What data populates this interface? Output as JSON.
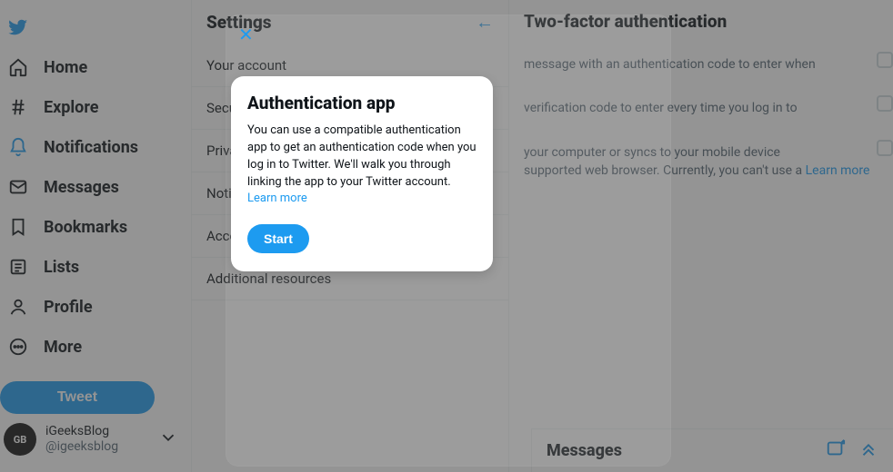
{
  "nav": {
    "home": "Home",
    "explore": "Explore",
    "notifications": "Notifications",
    "messages": "Messages",
    "bookmarks": "Bookmarks",
    "lists": "Lists",
    "profile": "Profile",
    "more": "More",
    "tweet": "Tweet"
  },
  "account": {
    "avatar_text": "GB",
    "name": "iGeeksBlog ",
    "handle": "@igeeksblog"
  },
  "settings": {
    "title": "Settings",
    "items": [
      "Your account",
      "Security and account access",
      "Privacy and safety",
      "Notifications",
      "Accessibility, display, and languages",
      "Additional resources"
    ]
  },
  "tfa": {
    "title": "Two-factor authentication",
    "sms_text": "message with an authentication code to enter when",
    "app_text": "verification code to enter every time you log in to",
    "key_text1": "your computer or syncs to your mobile device",
    "key_text2": "supported web browser. Currently, you can't use a",
    "learn": "Learn more"
  },
  "dialog": {
    "title": "Authentication app",
    "body": "You can use a compatible authentication app to get an authentication code when you log in to Twitter. We'll walk you through linking the app to your Twitter account. ",
    "learn": "Learn more",
    "start": "Start"
  },
  "messages_bar": {
    "title": "Messages"
  }
}
